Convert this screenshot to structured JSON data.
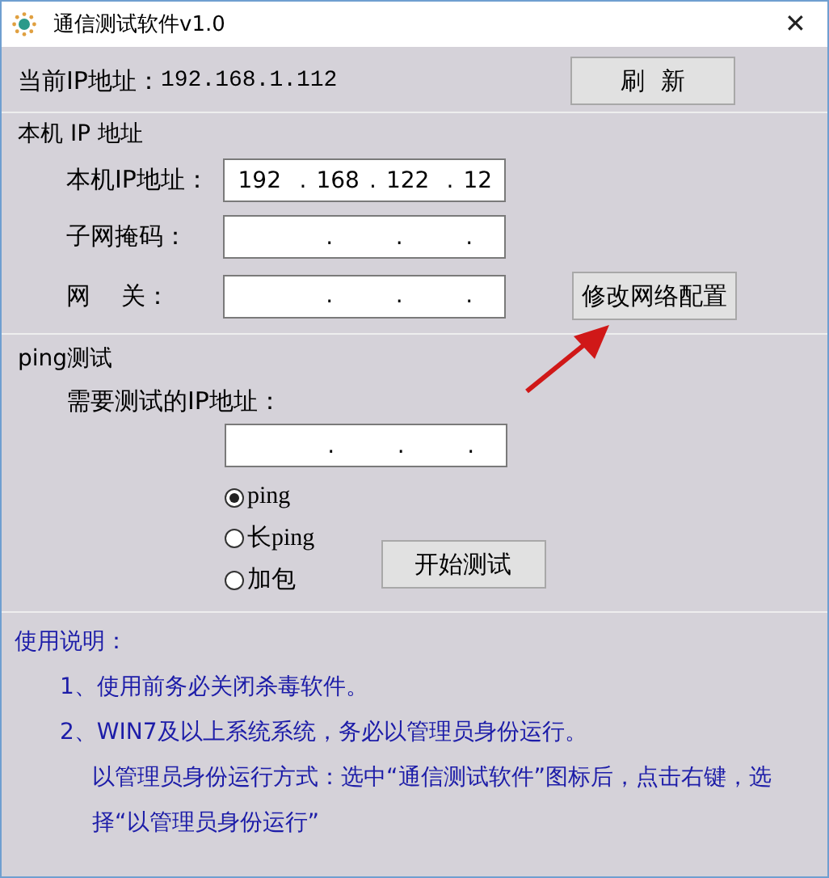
{
  "window": {
    "title": "通信测试软件v1.0",
    "close": "✕"
  },
  "current_ip": {
    "label": "当前IP地址：",
    "value": "192.168.1.112",
    "button": "刷  新"
  },
  "local_ip": {
    "title": "本机 IP 地址",
    "button": "修改网络配置",
    "fields": [
      {
        "label": "本机IP地址：",
        "octets": [
          "192",
          "168",
          "122",
          "12"
        ],
        "separators": [
          ".",
          ".",
          "."
        ]
      },
      {
        "label": "子网掩码：",
        "separators": [
          ".",
          ".",
          "."
        ]
      },
      {
        "label": "网    关：",
        "separators": [
          ".",
          ".",
          "."
        ]
      }
    ]
  },
  "ping_test": {
    "title": "ping测试",
    "label": "需要测试的IP地址：",
    "field": {
      "separators": [
        ".",
        ".",
        "."
      ]
    },
    "options": [
      {
        "label": "ping",
        "selected": true
      },
      {
        "label": "长ping",
        "selected": false
      },
      {
        "label": "加包",
        "selected": false
      }
    ],
    "button": "开始测试"
  },
  "instructions": {
    "title": "使用说明：",
    "lines": [
      {
        "text": "1、使用前务必关闭杀毒软件。",
        "indent": false
      },
      {
        "text": "2、WIN7及以上系统系统，务必以管理员身份运行。",
        "indent": false
      },
      {
        "text": "以管理员身份运行方式：选中“通信测试软件”图标后，点击右键，选择“以管理员身份运行”",
        "indent": true
      }
    ]
  }
}
